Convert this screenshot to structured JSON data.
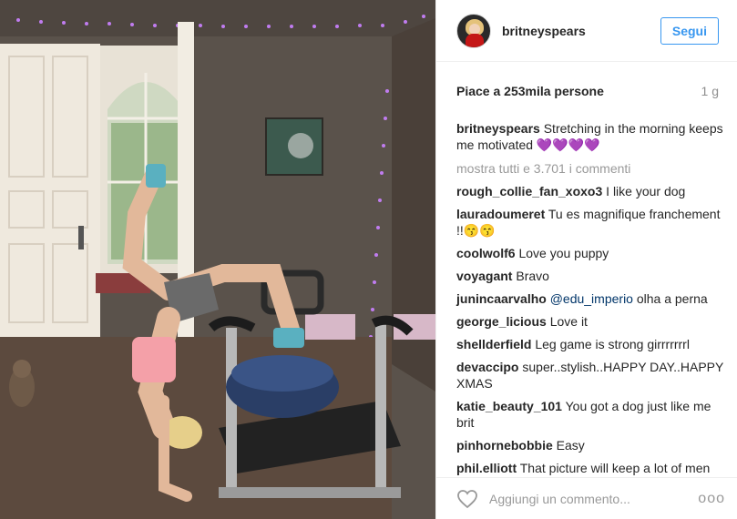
{
  "post": {
    "username": "britneyspears",
    "follow_label": "Segui",
    "likes": "Piace a 253mila persone",
    "time": "1 g",
    "caption": {
      "user": "britneyspears",
      "text": "Stretching in the morning keeps me motivated 💜💜💜💜"
    },
    "load_more": "mostra tutti e 3.701 i commenti",
    "comments": [
      {
        "user": "rough_collie_fan_xoxo3",
        "text": "I like your dog"
      },
      {
        "user": "lauradoumeret",
        "text": "Tu es magnifique franchement !!😙😙"
      },
      {
        "user": "coolwolf6",
        "text": "Love you puppy"
      },
      {
        "user": "voyagant",
        "text": "Bravo"
      },
      {
        "user": "junincaarvalho",
        "mention": "@edu_imperio",
        "text": "olha a perna"
      },
      {
        "user": "george_licious",
        "text": "Love it"
      },
      {
        "user": "shellderfield",
        "text": "Leg game is strong girrrrrrrl"
      },
      {
        "user": "devaccipo",
        "text": "super..stylish..HAPPY DAY..HAPPY XMAS"
      },
      {
        "user": "katie_beauty_101",
        "text": "You got a dog just like me brit"
      },
      {
        "user": "pinhornebobbie",
        "text": "Easy"
      },
      {
        "user": "phil.elliott",
        "text": "That picture will keep a lot of men motivated"
      }
    ],
    "add_comment_placeholder": "Aggiungi un commento...",
    "more_options": "ooo"
  }
}
